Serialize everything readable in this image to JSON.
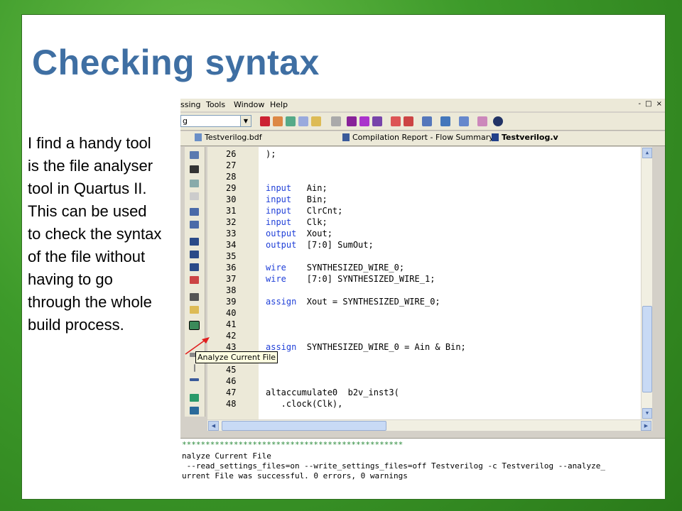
{
  "slide": {
    "title": "Checking syntax",
    "body": "I find a handy tool is the file analyser tool in Quartus II. This can be used to check the syntax of the file without having to go through the whole build process."
  },
  "menu": {
    "items": [
      "ssing",
      "Tools",
      "Window",
      "Help"
    ],
    "window_buttons": [
      "-",
      "□",
      "×"
    ]
  },
  "toolbar": {
    "combo_value": "g",
    "icons": [
      "compile-icon",
      "pencil-icon",
      "timing-icon",
      "netlist-icon",
      "chip-icon",
      "stop-icon",
      "start-icon",
      "analysis-icon",
      "step-icon",
      "clock-icon",
      "timer-icon",
      "report-icon",
      "programmer-icon",
      "assignment-icon",
      "chip-planner-icon",
      "help-icon"
    ]
  },
  "tabs": [
    {
      "label": "Testverilog.bdf",
      "active": false
    },
    {
      "label": "Compilation Report - Flow Summary",
      "active": false
    },
    {
      "label": "Testverilog.v",
      "active": true
    }
  ],
  "editor": {
    "lines": [
      {
        "num": "26",
        "code": ");"
      },
      {
        "num": "27",
        "code": ""
      },
      {
        "num": "28",
        "code": ""
      },
      {
        "num": "29",
        "kw": "input",
        "code": "   Ain;"
      },
      {
        "num": "30",
        "kw": "input",
        "code": "   Bin;"
      },
      {
        "num": "31",
        "kw": "input",
        "code": "   ClrCnt;"
      },
      {
        "num": "32",
        "kw": "input",
        "code": "   Clk;"
      },
      {
        "num": "33",
        "kw": "output",
        "code": "  Xout;"
      },
      {
        "num": "34",
        "kw": "output",
        "code": "  [7:0] SumOut;"
      },
      {
        "num": "35",
        "code": ""
      },
      {
        "num": "36",
        "kw": "wire",
        "code": "    SYNTHESIZED_WIRE_0;"
      },
      {
        "num": "37",
        "kw": "wire",
        "code": "    [7:0] SYNTHESIZED_WIRE_1;"
      },
      {
        "num": "38",
        "code": ""
      },
      {
        "num": "39",
        "kw": "assign",
        "code": "  Xout = SYNTHESIZED_WIRE_0;"
      },
      {
        "num": "40",
        "code": ""
      },
      {
        "num": "41",
        "code": ""
      },
      {
        "num": "42",
        "code": ""
      },
      {
        "num": "43",
        "kw": "assign",
        "code": "  SYNTHESIZED_WIRE_0 = Ain & Bin;"
      },
      {
        "num": "44",
        "code": ""
      },
      {
        "num": "45",
        "code": ""
      },
      {
        "num": "46",
        "code": ""
      },
      {
        "num": "47",
        "code": "altaccumulate0  b2v_inst3("
      },
      {
        "num": "48",
        "code": "   .clock(Clk),"
      }
    ]
  },
  "tooltip": "Analyze Current File",
  "console": {
    "lines": [
      "***********************************************",
      "nalyze Current File",
      " --read_settings_files=on --write_settings_files=off Testverilog -c Testverilog --analyze_",
      "urrent File was successful. 0 errors, 0 warnings"
    ]
  }
}
